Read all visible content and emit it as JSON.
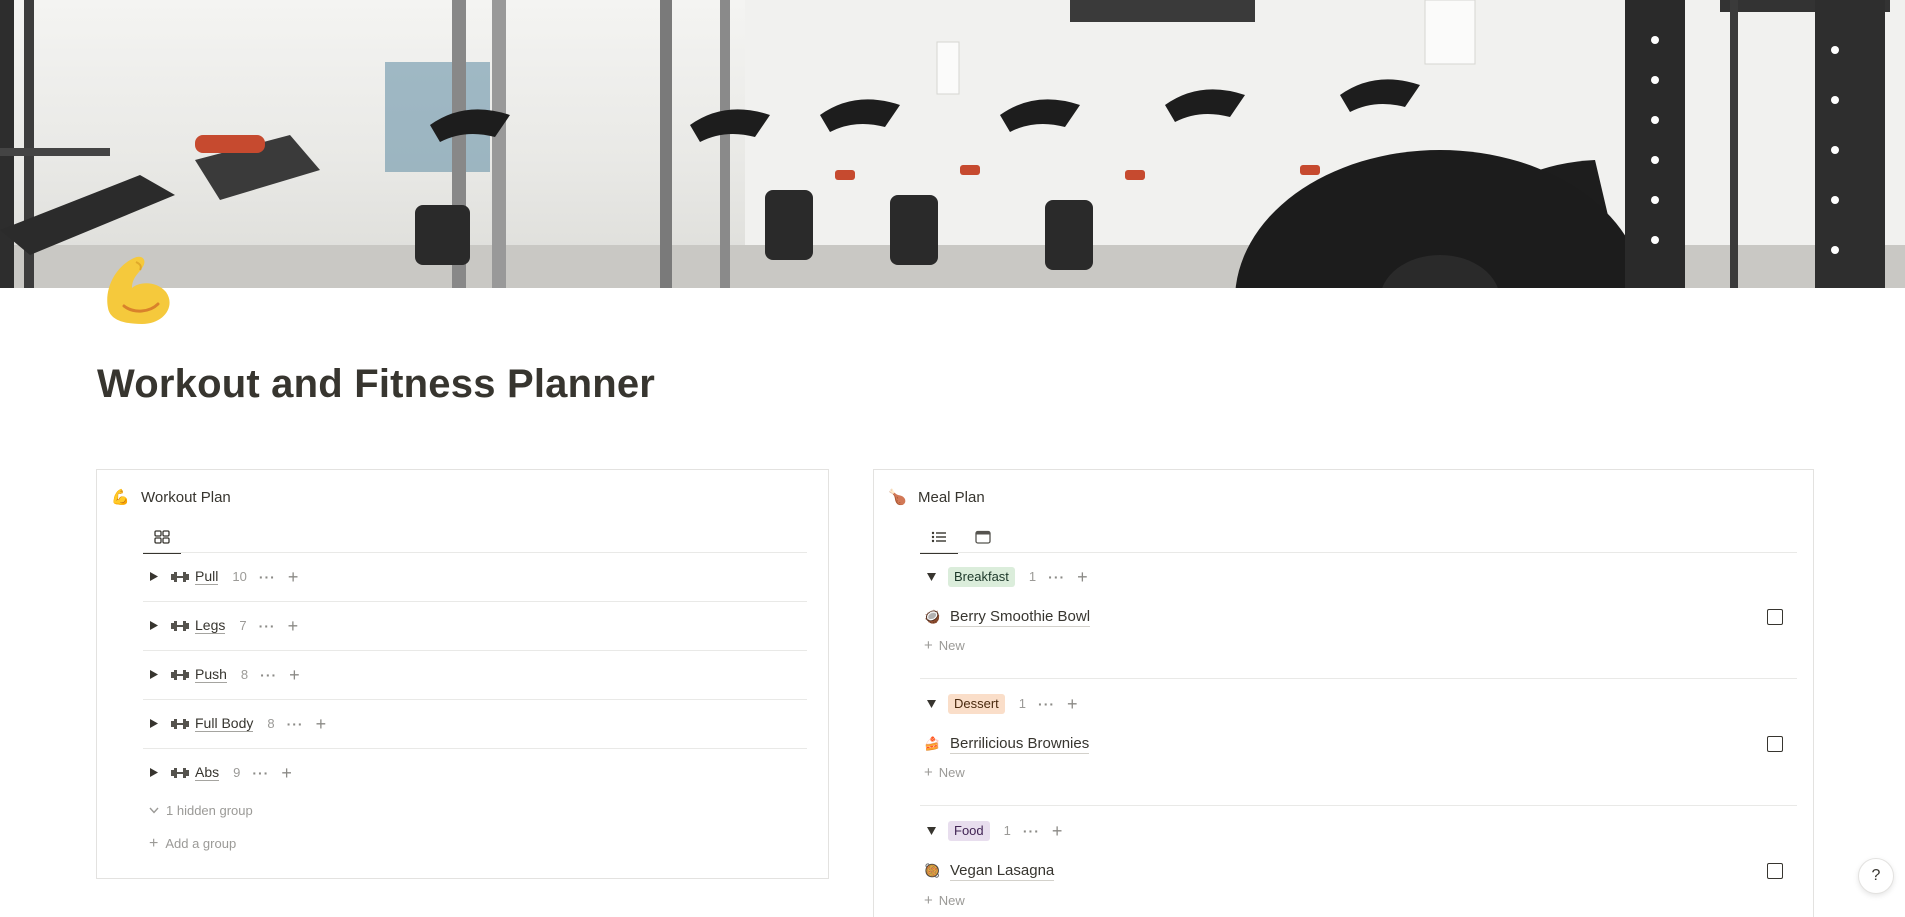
{
  "cover": {
    "image_name": "gym-with-spin-bikes-cover"
  },
  "page": {
    "icon": "flexed-biceps-icon",
    "title": "Workout and Fitness Planner"
  },
  "workout_plan": {
    "emoji": "💪",
    "title": "Workout Plan",
    "view_icon": "gallery-view-icon",
    "groups": [
      {
        "name": "Pull",
        "count": "10"
      },
      {
        "name": "Legs",
        "count": "7"
      },
      {
        "name": "Push",
        "count": "8"
      },
      {
        "name": "Full Body",
        "count": "8"
      },
      {
        "name": "Abs",
        "count": "9"
      }
    ],
    "hidden_groups": "1 hidden group",
    "add_group": "Add a group"
  },
  "meal_plan": {
    "emoji": "🍗",
    "title": "Meal Plan",
    "views": [
      "list-view-icon",
      "calendar-view-icon"
    ],
    "groups": [
      {
        "tag": "Breakfast",
        "count": "1",
        "color": "#dbeddb",
        "item": {
          "emoji": "🥥",
          "name": "Berry Smoothie Bowl"
        },
        "new": "New"
      },
      {
        "tag": "Dessert",
        "count": "1",
        "color": "#fadec9",
        "item": {
          "emoji": "🍰",
          "name": "Berrilicious Brownies"
        },
        "new": "New"
      },
      {
        "tag": "Food",
        "count": "1",
        "color": "#e8deee",
        "item": {
          "emoji": "🥘",
          "name": "Vegan Lasagna"
        },
        "new": "New"
      }
    ]
  },
  "help": {
    "label": "?"
  }
}
